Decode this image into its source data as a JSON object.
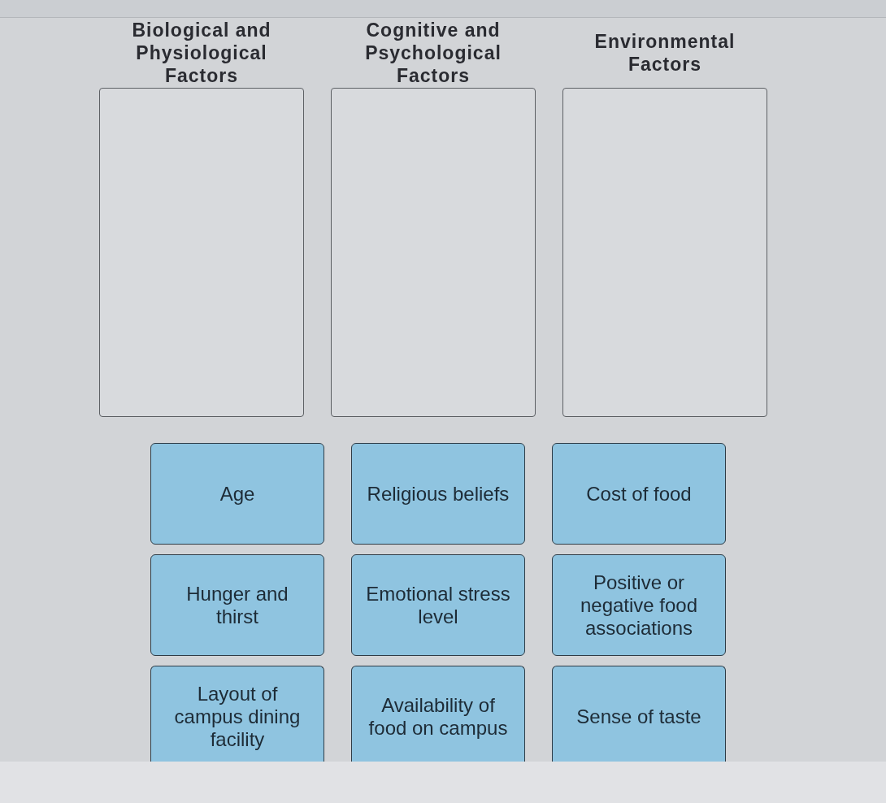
{
  "categories": [
    {
      "title": "Biological and Physiological Factors"
    },
    {
      "title": "Cognitive and Psychological Factors"
    },
    {
      "title": "Environmental Factors"
    }
  ],
  "cards": [
    "Age",
    "Religious beliefs",
    "Cost of food",
    "Hunger and thirst",
    "Emotional stress level",
    "Positive or negative food associations",
    "Layout of campus dining facility",
    "Availability of food on campus",
    "Sense of taste"
  ]
}
